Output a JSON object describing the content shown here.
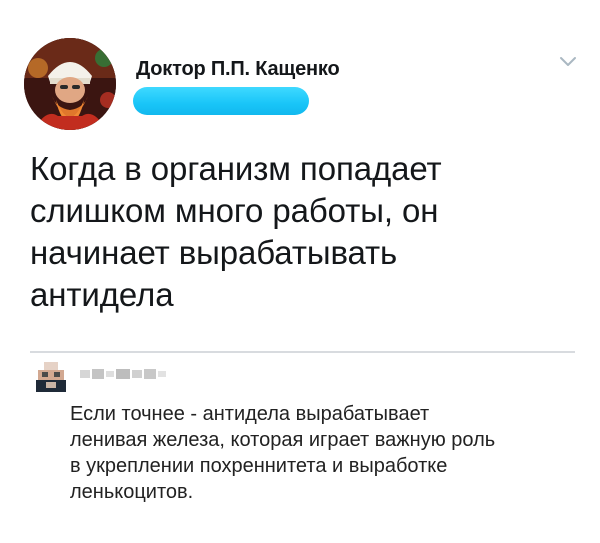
{
  "tweet": {
    "author_name": "Доктор П.П. Кащенко",
    "text_lines": [
      "Когда в организм попадает",
      "слишком много работы, он",
      "начинает вырабатывать",
      "антидела"
    ]
  },
  "reply": {
    "text_lines": [
      "Если точнее - антидела вырабатывает",
      "ленивая железа, которая играет важную роль",
      "в укреплении похреннитета и выработке",
      "леньକоцитов."
    ]
  },
  "icons": {
    "menu": "chevron-down-icon"
  },
  "colors": {
    "handle_redaction": "#19c5f8",
    "divider": "#d8dbdf",
    "chevron": "#aab8c2"
  }
}
